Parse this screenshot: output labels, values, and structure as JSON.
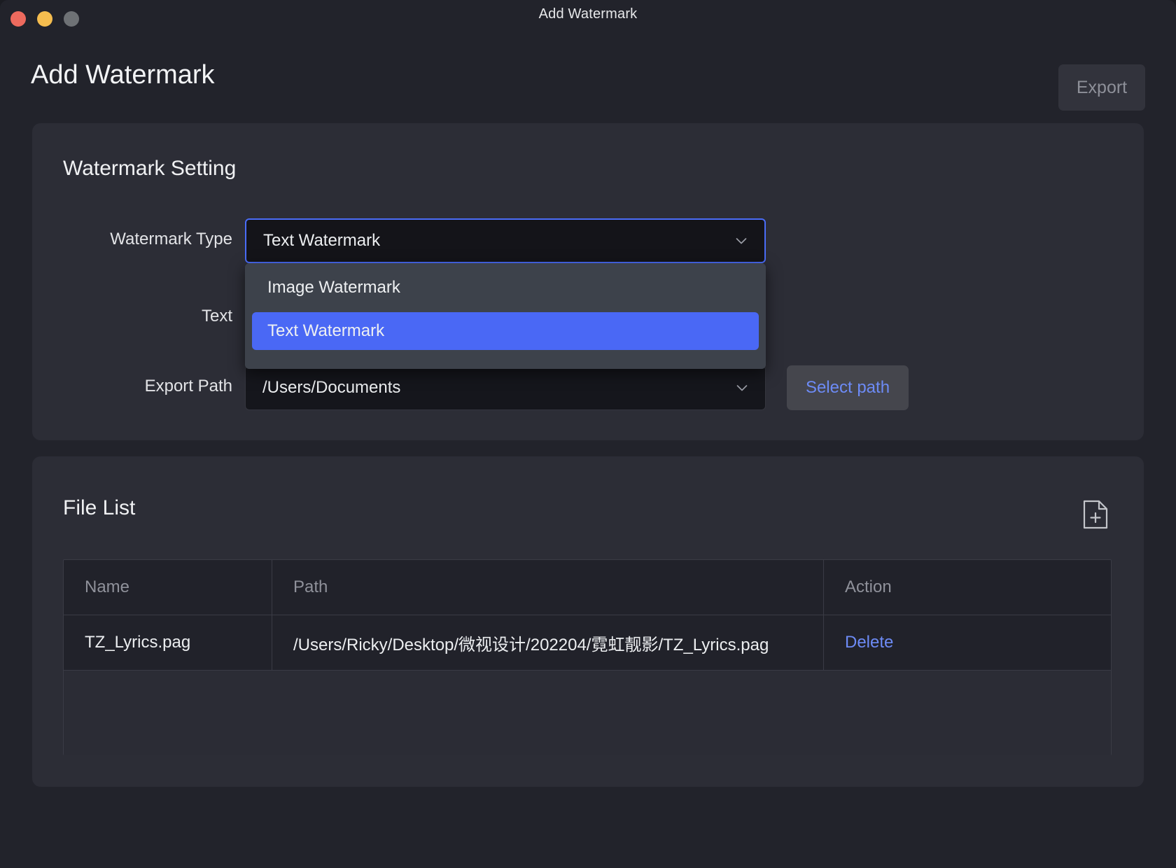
{
  "window": {
    "titlebar_text": "Add Watermark",
    "traffic_lights": [
      {
        "name": "close",
        "color": "#ed6a5e"
      },
      {
        "name": "minimize",
        "color": "#f5bd4f"
      },
      {
        "name": "zoom",
        "color": "#6e7175"
      }
    ]
  },
  "header": {
    "page_title": "Add Watermark",
    "export_label": "Export"
  },
  "settings": {
    "card_title": "Watermark Setting",
    "rows": {
      "type": {
        "label": "Watermark Type",
        "value": "Text Watermark",
        "chevron": "chevron-down-icon"
      },
      "text": {
        "label": "Text",
        "value": ""
      },
      "path": {
        "label": "Export Path",
        "value": "/Users/Documents",
        "chevron": "chevron-down-icon",
        "button_label": "Select path"
      }
    },
    "dropdown": {
      "open": true,
      "options": [
        {
          "label": "Image Watermark",
          "selected": false
        },
        {
          "label": "Text Watermark",
          "selected": true
        }
      ],
      "selected_color": "#4a68f5",
      "panel_color": "#3d424b"
    }
  },
  "file_list": {
    "card_title": "File List",
    "add_icon": "add-file-icon",
    "columns": [
      "Name",
      "Path",
      "Action"
    ],
    "rows": [
      {
        "name": "TZ_Lyrics.pag",
        "path": "/Users/Ricky/Desktop/微视设计/202204/霓虹靓影/TZ_Lyrics.pag",
        "action": "Delete"
      }
    ]
  },
  "colors": {
    "window_bg": "#22232b",
    "card_bg": "#2c2d36",
    "field_bg": "#15161c",
    "accent_blue": "#4a68f5",
    "link_blue": "#6d8bf6",
    "muted_text": "#8f919a"
  }
}
